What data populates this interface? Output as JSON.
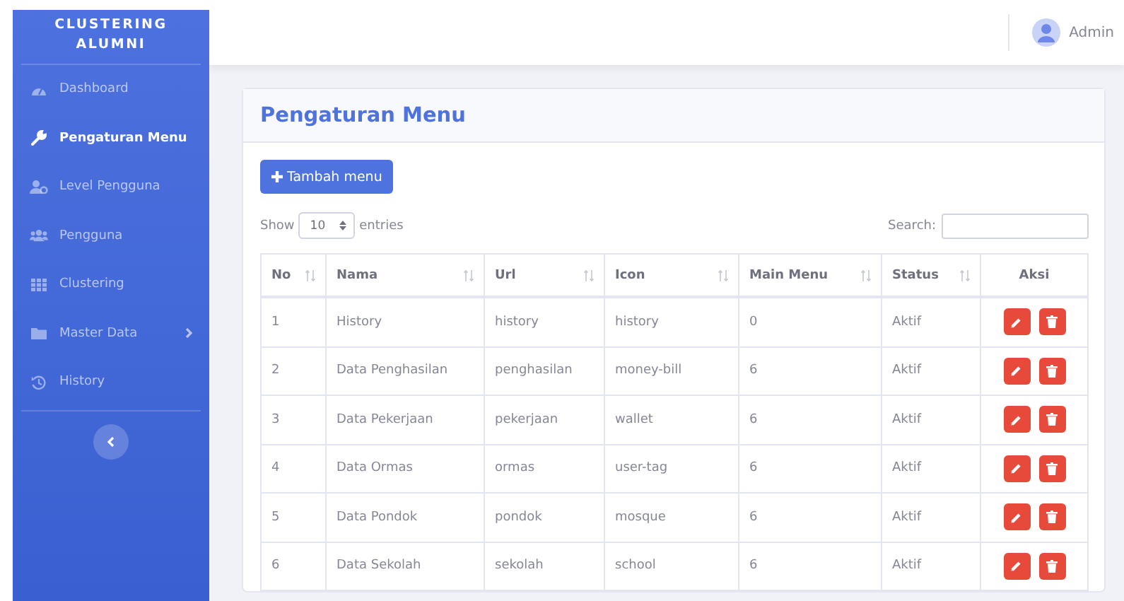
{
  "sidebar": {
    "brand": [
      "CLUSTERING",
      "ALUMNI"
    ],
    "items": [
      {
        "label": "Dashboard",
        "selected": false,
        "kind": "link"
      },
      {
        "label": "Pengaturan Menu",
        "selected": true,
        "kind": "link"
      },
      {
        "label": "Level Pengguna",
        "selected": false,
        "kind": "link"
      },
      {
        "label": "Pengguna",
        "selected": false,
        "kind": "link"
      },
      {
        "label": "Clustering",
        "selected": false,
        "kind": "link"
      },
      {
        "label": "Master Data",
        "selected": false,
        "kind": "dropdown"
      },
      {
        "label": "History",
        "selected": false,
        "kind": "link"
      }
    ]
  },
  "topbar": {
    "user": "Admin"
  },
  "card": {
    "title": "Pengaturan Menu",
    "add_button": "Tambah menu",
    "length": {
      "before": "Show",
      "value": "10",
      "after": "entries"
    },
    "search": {
      "label": "Search:"
    },
    "table": {
      "columns": [
        {
          "label": "No",
          "sortable": true
        },
        {
          "label": "Nama",
          "sortable": true
        },
        {
          "label": "Url",
          "sortable": true
        },
        {
          "label": "Icon",
          "sortable": true
        },
        {
          "label": "Main Menu",
          "sortable": true
        },
        {
          "label": "Status",
          "sortable": true
        },
        {
          "label": "Aksi",
          "sortable": false
        }
      ],
      "rows": [
        [
          "1",
          "History",
          "history",
          "history",
          "0",
          "Aktif"
        ],
        [
          "2",
          "Data Penghasilan",
          "penghasilan",
          "money-bill",
          "6",
          "Aktif"
        ],
        [
          "3",
          "Data Pekerjaan",
          "pekerjaan",
          "wallet",
          "6",
          "Aktif"
        ],
        [
          "4",
          "Data Ormas",
          "ormas",
          "user-tag",
          "6",
          "Aktif"
        ],
        [
          "5",
          "Data Pondok",
          "pondok",
          "mosque",
          "6",
          "Aktif"
        ],
        [
          "6",
          "Data Sekolah",
          "sekolah",
          "school",
          "6",
          "Aktif"
        ]
      ]
    }
  }
}
